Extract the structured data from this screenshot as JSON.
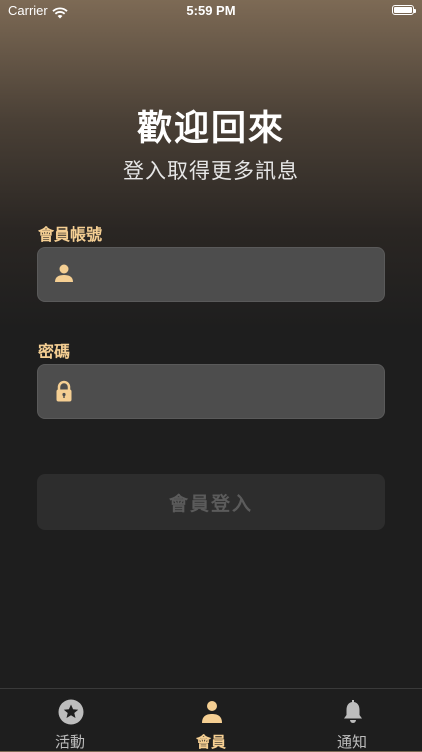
{
  "status_bar": {
    "carrier": "Carrier",
    "time": "5:59 PM"
  },
  "header": {
    "title": "歡迎回來",
    "subtitle": "登入取得更多訊息"
  },
  "form": {
    "account_label": "會員帳號",
    "account_value": "",
    "password_label": "密碼",
    "password_value": "",
    "submit_label": "會員登入"
  },
  "tabs": [
    {
      "label": "活動",
      "icon": "star-circle-icon",
      "active": false
    },
    {
      "label": "會員",
      "icon": "person-icon",
      "active": true
    },
    {
      "label": "通知",
      "icon": "bell-icon",
      "active": false
    }
  ],
  "colors": {
    "accent": "#f5cf93",
    "field_bg": "#4d4d4d",
    "button_disabled_bg": "#2d2d2d",
    "background": "#1e1e1e"
  }
}
